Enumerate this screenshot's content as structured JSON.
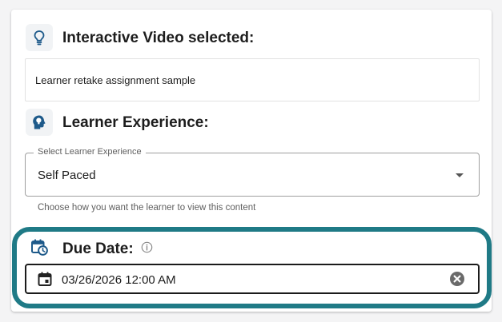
{
  "content": {
    "section_title": "Interactive Video selected:",
    "item_title": "Learner retake assignment sample"
  },
  "experience": {
    "section_title": "Learner Experience:",
    "select_label": "Select Learner Experience",
    "selected_value": "Self Paced",
    "helper_text": "Choose how you want the learner to view this content"
  },
  "due_date": {
    "section_title": "Due Date:",
    "value": "03/26/2026 12:00 AM"
  },
  "icons": {
    "content": "lightbulb-icon",
    "experience": "head-lightbulb-icon",
    "due_date": "calendar-clock-icon",
    "info": "info-icon",
    "date_field": "calendar-icon",
    "clear": "clear-icon",
    "dropdown": "chevron-down-icon"
  },
  "colors": {
    "accent": "#1f7a86",
    "icon": "#1e5a8a",
    "highlight_border": "#1f7a86"
  }
}
